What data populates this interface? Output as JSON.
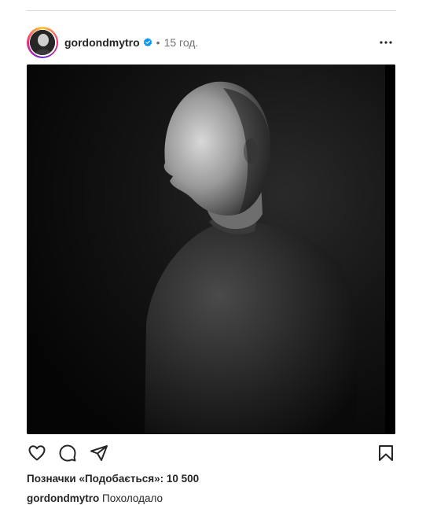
{
  "post": {
    "username": "gordondmytro",
    "separator": "•",
    "time_ago": "15 год.",
    "verified": true,
    "likes_text": "Позначки «Подобається»: 10 500",
    "caption_user": "gordondmytro",
    "caption_text": "Похолодало"
  },
  "icons": {
    "like": "heart-icon",
    "comment": "comment-icon",
    "share": "send-icon",
    "save": "bookmark-icon",
    "more": "more-options-icon",
    "verified": "verified-badge-icon"
  },
  "colors": {
    "verified_blue": "#0095f6",
    "secondary_text": "#737373",
    "divider": "#dbdbdb"
  }
}
